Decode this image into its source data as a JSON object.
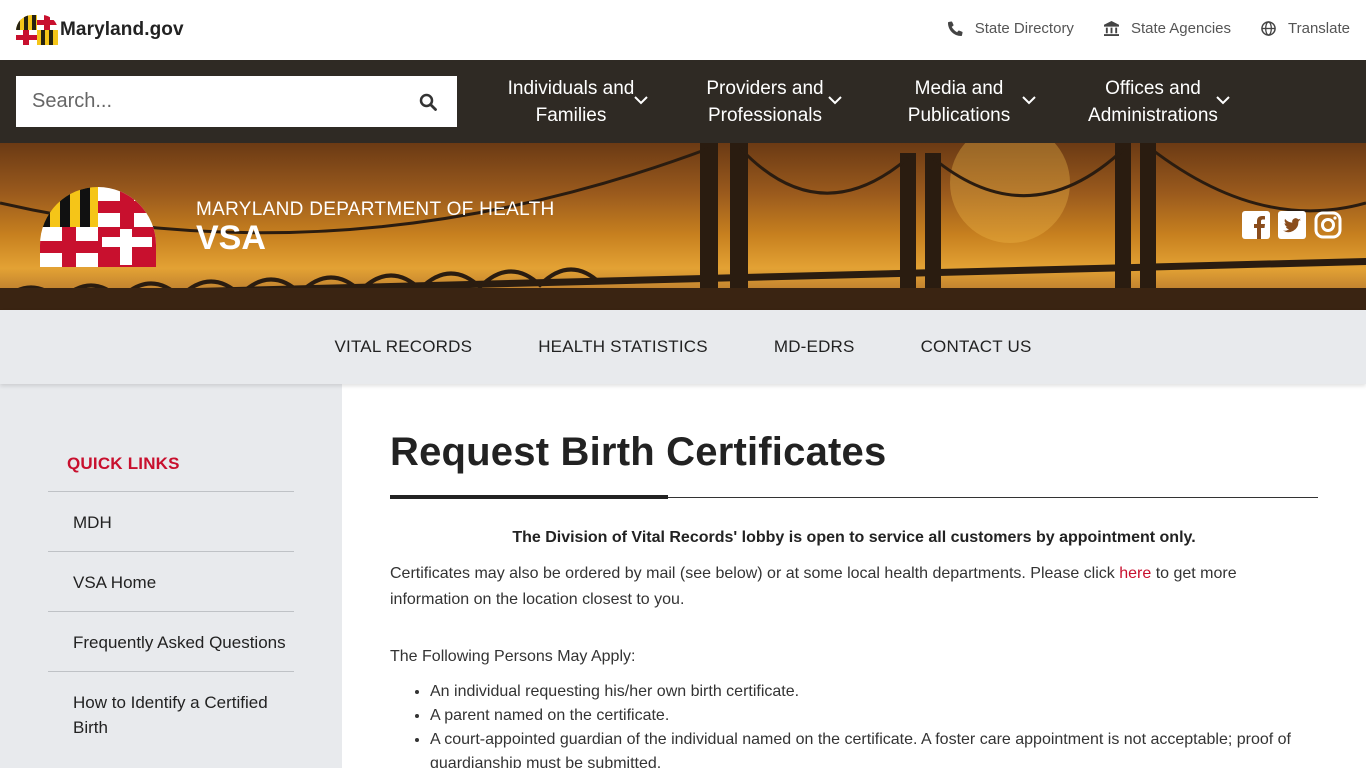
{
  "topbar": {
    "logo_text": "Maryland.gov",
    "links": [
      "State Directory",
      "State Agencies",
      "Translate"
    ]
  },
  "nav": {
    "search_placeholder": "Search...",
    "items": [
      {
        "label": "Individuals and Families"
      },
      {
        "label": "Providers and Professionals"
      },
      {
        "label": "Media and Publications"
      },
      {
        "label": "Offices and Administrations"
      }
    ]
  },
  "hero": {
    "dept_name": "MARYLAND DEPARTMENT OF HEALTH",
    "dept_sub": "VSA",
    "social_icons": [
      "facebook-icon",
      "twitter-icon",
      "instagram-icon"
    ]
  },
  "subnav": [
    "VITAL RECORDS",
    "HEALTH STATISTICS",
    "MD-EDRS",
    "CONTACT US"
  ],
  "sidebar": {
    "title": "QUICK LINKS",
    "items": [
      "MDH",
      "VSA Home",
      "Frequently Asked Questions",
      "How to Identify a Certified Birth"
    ]
  },
  "main": {
    "title": "Request Birth Certificates",
    "notice": "The Division of Vital Records' lobby is open to service all customers by appointment only.",
    "para_before": "Certificates may also be ordered by mail (see below) or at some local health departments. Please click ",
    "para_link": "here",
    "para_after": " to get more information on the location closest to you.",
    "para2": "The Following Persons May Apply:",
    "bullets": [
      "An individual requesting his/her own birth certificate.",
      "A parent named on the certificate.",
      "A court-appointed guardian of the individual named on the certificate. A foster care appointment is not acceptable; proof of guardianship must be submitted."
    ]
  },
  "colors": {
    "accent_red": "#c8102e",
    "nav_bg": "#2f2a24",
    "subnav_bg": "#e8eaed"
  }
}
